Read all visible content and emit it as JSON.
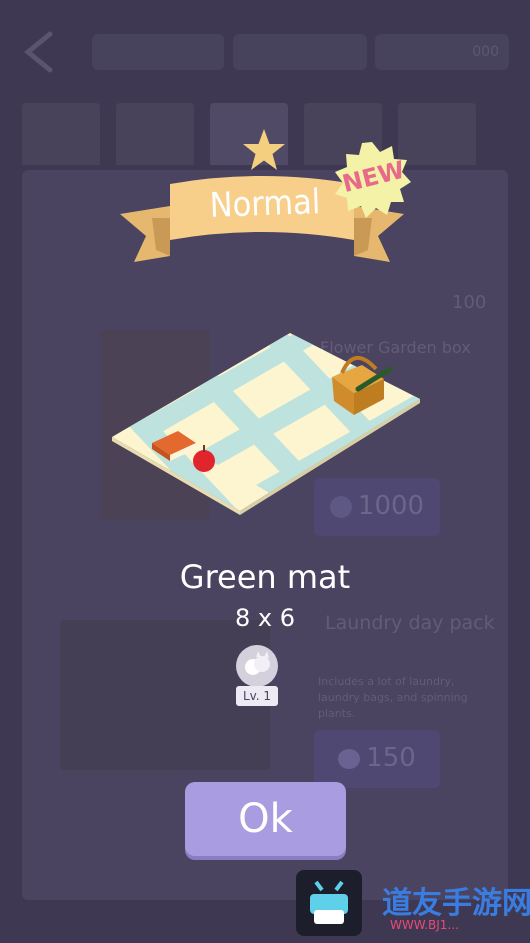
{
  "background": {
    "currency_pills": [
      "",
      "",
      "000"
    ],
    "pack1_name": "Flower Garden box",
    "pack1_price": "1000",
    "pack2_name": "Laundry day pack",
    "pack2_desc": "Includes a lot of laundry, laundry bags, and spinning plants.",
    "pack2_price": "150",
    "side_count": "100"
  },
  "popup": {
    "rarity": "Normal",
    "new_badge": "NEW",
    "item_name": "Green mat",
    "item_size": "8 x 6",
    "level": "Lv. 1",
    "ok_label": "Ok"
  },
  "watermark": {
    "text": "道友手游网",
    "url": "WWW.BJ1..."
  },
  "colors": {
    "background": "#3f3852",
    "ribbon": "#f7cf8a",
    "new_badge": "#f3f2a6",
    "new_text": "#e86a8b",
    "ok_button": "#a99ce0",
    "mat": "#fdf5cf",
    "mat_stripes": "#b3dfe0"
  }
}
